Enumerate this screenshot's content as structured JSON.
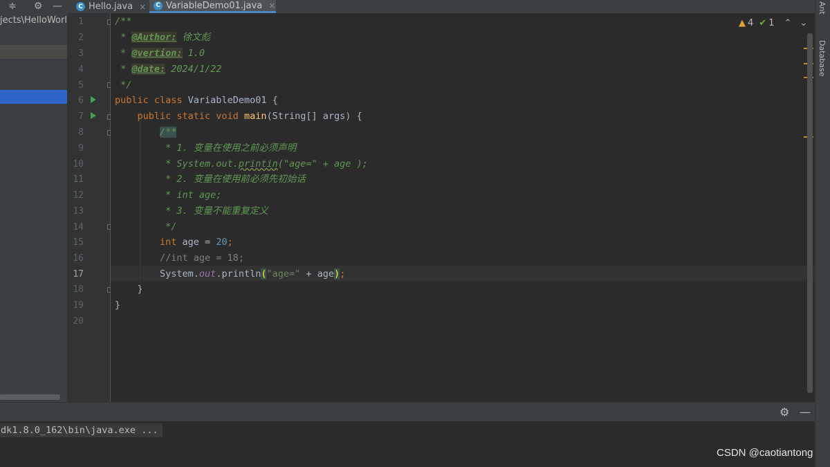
{
  "toolbar": {
    "collapse_icon": "≑",
    "settings_icon": "⚙",
    "hide_icon": "—"
  },
  "tabs": [
    {
      "icon": "C",
      "label": "Hello.java",
      "close": "×"
    },
    {
      "icon": "C",
      "label": "VariableDemo01.java",
      "close": "×"
    }
  ],
  "project": {
    "path": "jects\\HelloWorld"
  },
  "inspections": {
    "warnings": "4",
    "weak_warnings": "1",
    "up": "⌃",
    "down": "⌄"
  },
  "line_numbers": [
    "1",
    "2",
    "3",
    "4",
    "5",
    "6",
    "7",
    "8",
    "9",
    "10",
    "11",
    "12",
    "13",
    "14",
    "15",
    "16",
    "17",
    "18",
    "19",
    "20"
  ],
  "code": {
    "l1": "/**",
    "l2_star": " * ",
    "l2_tag": "@Author:",
    "l2_val": " 徐文彪",
    "l3_star": " * ",
    "l3_tag": "@vertion:",
    "l3_val": " 1.0",
    "l4_star": " * ",
    "l4_tag": "@date:",
    "l4_val": " 2024/1/22",
    "l5": " */",
    "l6_kw": "public class ",
    "l6_name": "VariableDemo01 {",
    "l7_kw": "    public static void ",
    "l7_fn": "main",
    "l7_rest": "(String[] args) {",
    "l8_indent": "        ",
    "l8": "/**",
    "l9": "         * 1. 变量在使用之前必须声明",
    "l10_a": "         * System.out.",
    "l10_b": "printin",
    "l10_c": "(\"age=\" + age );",
    "l11": "         * 2. 变量在使用前必须先初始话",
    "l12": "         * int age;",
    "l13": "         * 3. 变量不能重复定义",
    "l14": "         */",
    "l15_indent": "        ",
    "l15_kw": "int",
    "l15_mid": " age = ",
    "l15_num": "20",
    "l15_end": ";",
    "l16": "        //int age = 18;",
    "l17_a": "        System.",
    "l17_fld": "out",
    "l17_b": ".println",
    "l17_po": "(",
    "l17_str": "\"age=\"",
    "l17_c": " + age",
    "l17_pc": ")",
    "l17_end": ";",
    "l18": "    }",
    "l19": "}"
  },
  "right_strip": {
    "ant": "Ant",
    "database": "Database"
  },
  "run_panel": {
    "console_line": "dk1.8.0_162\\bin\\java.exe ...",
    "settings_icon": "⚙",
    "hide_icon": "—"
  },
  "watermark": "CSDN @caotiantong"
}
